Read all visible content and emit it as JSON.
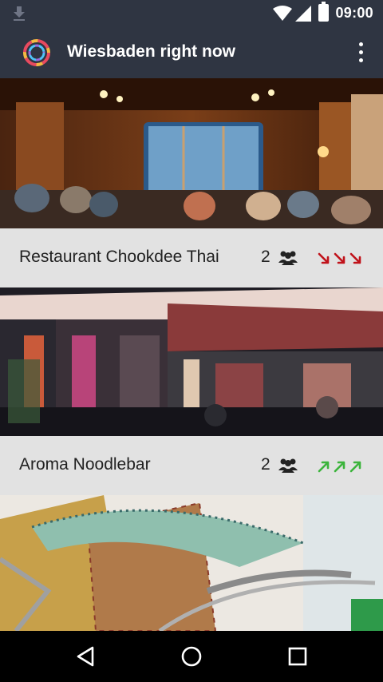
{
  "status_bar": {
    "time": "09:00"
  },
  "app_bar": {
    "title": "Wiesbaden right now"
  },
  "places": [
    {
      "name": "Restaurant Chookdee Thai",
      "count": "2",
      "trend": "down",
      "trend_color": "#c0121a"
    },
    {
      "name": "Aroma Noodlebar",
      "count": "2",
      "trend": "up",
      "trend_color": "#3cb43c"
    }
  ],
  "icons": {
    "download": "download-icon",
    "wifi": "wifi-icon",
    "signal": "signal-icon",
    "battery": "battery-icon",
    "logo": "app-logo",
    "menu": "overflow-menu-icon",
    "people": "people-icon",
    "back": "back-icon",
    "home": "home-icon",
    "recents": "recents-icon"
  },
  "colors": {
    "bar": "#2f3542",
    "row": "#e2e2e2",
    "down": "#c0121a",
    "up": "#3cb43c"
  }
}
